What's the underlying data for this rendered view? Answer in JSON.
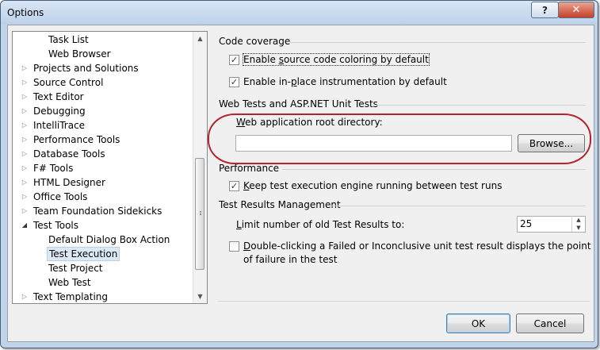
{
  "window": {
    "title": "Options",
    "help_label": "?",
    "close_label": "✕",
    "accent_close": "#c4402a"
  },
  "tree": {
    "items": [
      {
        "label": "Task List",
        "selected": false,
        "level": 1,
        "expander": ""
      },
      {
        "label": "Web Browser",
        "selected": false,
        "level": 1,
        "expander": ""
      },
      {
        "label": "Projects and Solutions",
        "selected": false,
        "level": 0,
        "expander": "collapsed"
      },
      {
        "label": "Source Control",
        "selected": false,
        "level": 0,
        "expander": "collapsed"
      },
      {
        "label": "Text Editor",
        "selected": false,
        "level": 0,
        "expander": "collapsed"
      },
      {
        "label": "Debugging",
        "selected": false,
        "level": 0,
        "expander": "collapsed"
      },
      {
        "label": "IntelliTrace",
        "selected": false,
        "level": 0,
        "expander": "collapsed"
      },
      {
        "label": "Performance Tools",
        "selected": false,
        "level": 0,
        "expander": "collapsed"
      },
      {
        "label": "Database Tools",
        "selected": false,
        "level": 0,
        "expander": "collapsed"
      },
      {
        "label": "F# Tools",
        "selected": false,
        "level": 0,
        "expander": "collapsed"
      },
      {
        "label": "HTML Designer",
        "selected": false,
        "level": 0,
        "expander": "collapsed"
      },
      {
        "label": "Office Tools",
        "selected": false,
        "level": 0,
        "expander": "collapsed"
      },
      {
        "label": "Team Foundation Sidekicks",
        "selected": false,
        "level": 0,
        "expander": "collapsed"
      },
      {
        "label": "Test Tools",
        "selected": false,
        "level": 0,
        "expander": "expanded"
      },
      {
        "label": "Default Dialog Box Action",
        "selected": false,
        "level": 1,
        "expander": ""
      },
      {
        "label": "Test Execution",
        "selected": true,
        "level": 1,
        "expander": ""
      },
      {
        "label": "Test Project",
        "selected": false,
        "level": 1,
        "expander": ""
      },
      {
        "label": "Web Test",
        "selected": false,
        "level": 1,
        "expander": ""
      },
      {
        "label": "Text Templating",
        "selected": false,
        "level": 0,
        "expander": "collapsed"
      }
    ],
    "scroll_up": "▲",
    "scroll_down": "▼",
    "scroll_position": 0.55
  },
  "code_coverage": {
    "heading": "Code coverage",
    "source_coloring": {
      "pre": "Enable ",
      "ul": "s",
      "post": "ource code coloring by default",
      "checked": true
    },
    "inplace": {
      "pre": "Enable in-",
      "ul": "p",
      "post": "lace instrumentation by default",
      "checked": true
    }
  },
  "web_tests": {
    "heading": "Web Tests and ASP.NET Unit Tests",
    "root_dir_label_ul": "W",
    "root_dir_label_rest": "eb application root directory:",
    "root_dir_value": "",
    "browse_label": "Browse..."
  },
  "performance": {
    "heading": "Performance",
    "keep_engine": {
      "ul": "K",
      "post": "eep test execution engine running between test runs",
      "checked": true
    }
  },
  "results_mgmt": {
    "heading": "Test Results Management",
    "limit_label_ul": "L",
    "limit_label_rest": "imit number of old Test Results to:",
    "limit_value": "25",
    "double_click": {
      "ul": "D",
      "line1": "ouble-clicking a Failed or Inconclusive unit test result displays the point",
      "line2": "of failure in the test",
      "checked": false
    }
  },
  "buttons": {
    "ok": "OK",
    "cancel": "Cancel"
  },
  "check_glyph": "✓"
}
